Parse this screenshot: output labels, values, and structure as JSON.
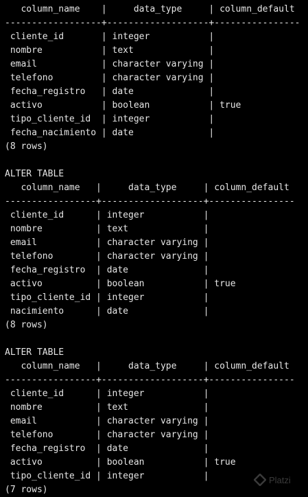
{
  "terminal": {
    "lines": [
      "   column_name    |     data_type     | column_default",
      "------------------+-------------------+----------------",
      " cliente_id       | integer           |",
      " nombre           | text              |",
      " email            | character varying |",
      " telefono         | character varying |",
      " fecha_registro   | date              |",
      " activo           | boolean           | true",
      " tipo_cliente_id  | integer           |",
      " fecha_nacimiento | date              |",
      "(8 rows)",
      "",
      "ALTER TABLE",
      "   column_name   |     data_type     | column_default",
      "-----------------+-------------------+----------------",
      " cliente_id      | integer           |",
      " nombre          | text              |",
      " email           | character varying |",
      " telefono        | character varying |",
      " fecha_registro  | date              |",
      " activo          | boolean           | true",
      " tipo_cliente_id | integer           |",
      " nacimiento      | date              |",
      "(8 rows)",
      "",
      "ALTER TABLE",
      "   column_name   |     data_type     | column_default",
      "-----------------+-------------------+----------------",
      " cliente_id      | integer           |",
      " nombre          | text              |",
      " email           | character varying |",
      " telefono        | character varying |",
      " fecha_registro  | date              |",
      " activo          | boolean           | true",
      " tipo_cliente_id | integer           |",
      "(7 rows)"
    ]
  },
  "watermark": {
    "icon": "platzi-logo-icon",
    "text": "Platzi"
  },
  "colors": {
    "background": "#000000",
    "text": "#e6e6e6"
  }
}
